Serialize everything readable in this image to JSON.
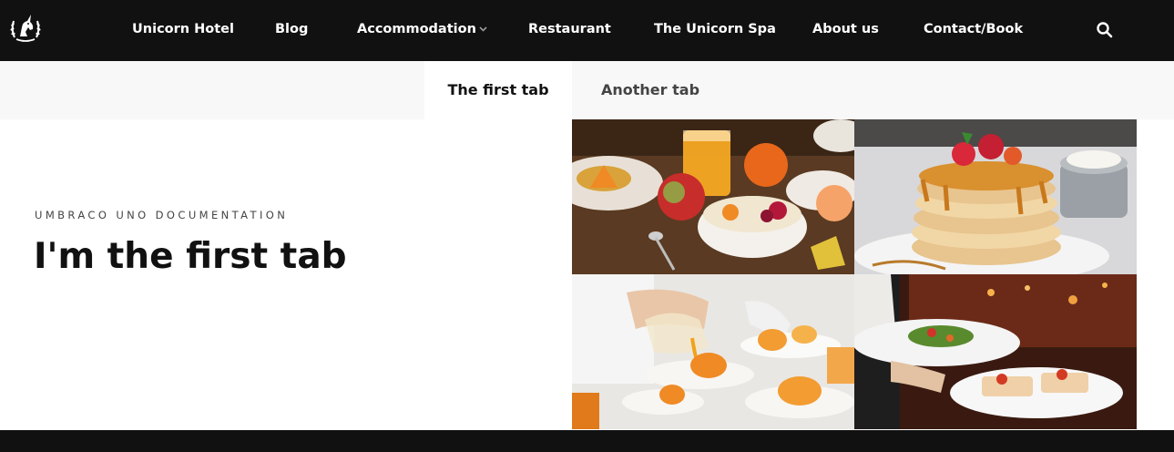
{
  "nav": {
    "items": [
      {
        "label": "Unicorn Hotel"
      },
      {
        "label": "Blog"
      },
      {
        "label": "Accommodation"
      },
      {
        "label": "Restaurant"
      },
      {
        "label": "The Unicorn Spa"
      },
      {
        "label": "About us"
      },
      {
        "label": "Contact/Book"
      }
    ],
    "logo_icon": "unicorn-laurel-logo",
    "search_icon": "search-icon",
    "dropdown_icon": "chevron-down-icon"
  },
  "tabs": [
    {
      "label": "The first tab",
      "active": true
    },
    {
      "label": "Another tab",
      "active": false
    }
  ],
  "content": {
    "eyebrow": "UMBRACO UNO DOCUMENTATION",
    "heading": "I'm the first tab"
  },
  "gallery": {
    "images": [
      {
        "name": "breakfast-spread-photo"
      },
      {
        "name": "pancake-stack-photo"
      },
      {
        "name": "chef-plating-photo"
      },
      {
        "name": "waiter-serving-photo"
      }
    ]
  },
  "colors": {
    "nav_bg": "#111111",
    "tabbar_bg": "#f8f8f8",
    "text_dark": "#111111",
    "footer_bg": "#111111"
  }
}
